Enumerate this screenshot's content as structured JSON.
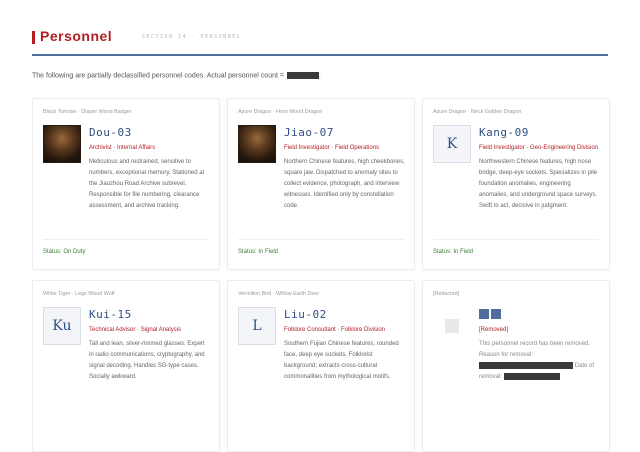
{
  "header": {
    "title": "Personnel",
    "subtitle": "SECTION 14 · PERSONNEL"
  },
  "intro": {
    "text": "The following are partially declassified personnel codes. Actual personnel count ="
  },
  "cards": [
    {
      "aliases": "Black Tortoise · Diaper Wood Badger",
      "code": "Dou-03",
      "role": "Archivist · Internal Affairs",
      "description": "Meticulous and restrained, sensitive to numbers, exceptional memory. Stationed at the Jiaozhou Road Archive subrevel. Responsible for file numbering, clearance assessment, and archive tracking.",
      "status": "Status: On Duty"
    },
    {
      "aliases": "Azure Dragon · Horn Wood Dragon",
      "code": "Jiao-07",
      "role": "Field Investigator · Field Operations",
      "description": "Northern Chinese features, high cheekbones, square jaw. Dispatched to anomaly sites to collect evidence, photograph, and interview witnesses. Identified only by constellation code.",
      "status": "Status: In Field"
    },
    {
      "aliases": "Azure Dragon · Neck Golden Dragon",
      "code": "Kang-09",
      "avatar_letter": "K",
      "role": "Field Investigator · Geo-Engineering Division",
      "description": "Northwestern Chinese features, high nose bridge, deep-eye sockets. Specializes in pile foundation anomalies, engineering anomalies, and underground space surveys. Swift to act, decisive in judgment.",
      "status": "Status: In Field"
    },
    {
      "aliases": "White Tiger · Legs Wood Wolf",
      "code": "Kui-15",
      "avatar_letter": "Ku",
      "role": "Technical Advisor · Signal Analysis",
      "description": "Tall and lean, silver-rimmed glasses. Expert in radio communications, cryptography, and signal decoding. Handles SG-type cases. Socially awkward."
    },
    {
      "aliases": "Vermilion Bird · Willow Earth Deer",
      "code": "Liu-02",
      "avatar_letter": "L",
      "role": "Folklore Consultant · Folklore Division",
      "description": "Southern Fujian Chinese features, rounded face, deep eye sockets. Folklorist background; extracts cross-cultural commonalities from mythological motifs."
    },
    {
      "aliases": "[Redacted]",
      "removed_label": "[Removed]",
      "removed_text": "This personnel record has been removed. Reason for removal:",
      "removed_date_label": "Date of removal:"
    }
  ]
}
